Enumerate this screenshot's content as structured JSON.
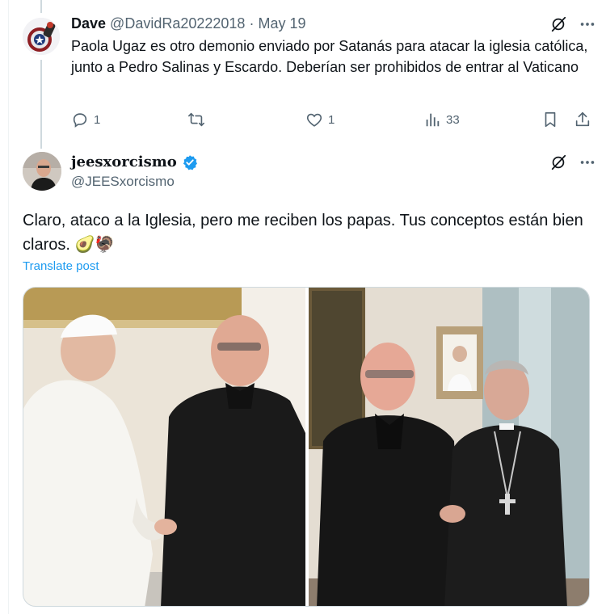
{
  "parent_tweet": {
    "display_name": "Dave",
    "handle": "@DavidRa20222018",
    "separator": "·",
    "date": "May 19",
    "text": "Paola Ugaz es otro demonio enviado por Satanás para atacar la iglesia católica, junto a Pedro Salinas y Escardo. Deberían ser prohibidos de entrar al Vaticano",
    "actions": {
      "reply_count": "1",
      "retweet_count": "",
      "like_count": "1",
      "views_count": "33"
    }
  },
  "main_tweet": {
    "display_name": "jeesxorcismo",
    "handle": "@JEESxorcismo",
    "text": "Claro, ataco a la Iglesia, pero me reciben los papas. Tus conceptos están bien claros. 🥑🦃",
    "translate_label": "Translate post",
    "media": [
      "photo-pope-handshake",
      "photo-cardinal-handshake"
    ]
  },
  "colors": {
    "text": "#0f1419",
    "secondary": "#536471",
    "accent": "#1d9bf0",
    "border": "#cfd9de"
  },
  "icons": [
    "grok-icon",
    "more-icon",
    "reply-icon",
    "retweet-icon",
    "like-icon",
    "views-icon",
    "bookmark-icon",
    "share-icon",
    "verified-badge-icon"
  ]
}
